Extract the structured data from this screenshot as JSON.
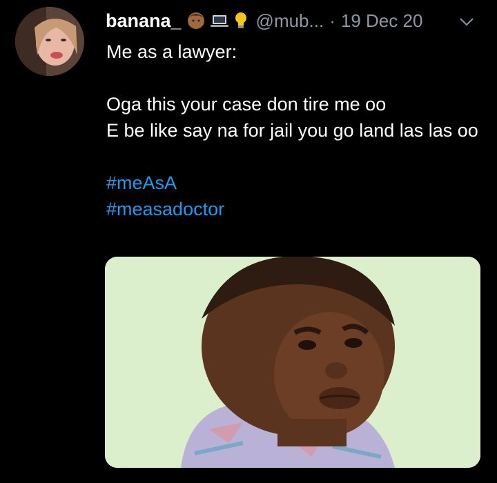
{
  "tweet": {
    "author": {
      "display_name": "banana_",
      "emojis": [
        "person-emoji",
        "laptop-emoji",
        "light-bulb-emoji"
      ],
      "handle": "@mub...",
      "avatar_icon": "avatar-photo"
    },
    "separator": "·",
    "date": "19 Dec 20",
    "more_icon": "chevron-down-icon",
    "text": {
      "line1": "Me as a lawyer:",
      "line2": "Oga this your case don tire me oo",
      "line3": "E be like say na for jail you go land las las oo"
    },
    "hashtags": [
      "#meAsA",
      "#measadoctor"
    ],
    "media": {
      "icon": "child-photo"
    }
  },
  "colors": {
    "background": "#000000",
    "text": "#ffffff",
    "secondary_text": "#8b98a5",
    "link": "#1d9bf0"
  }
}
